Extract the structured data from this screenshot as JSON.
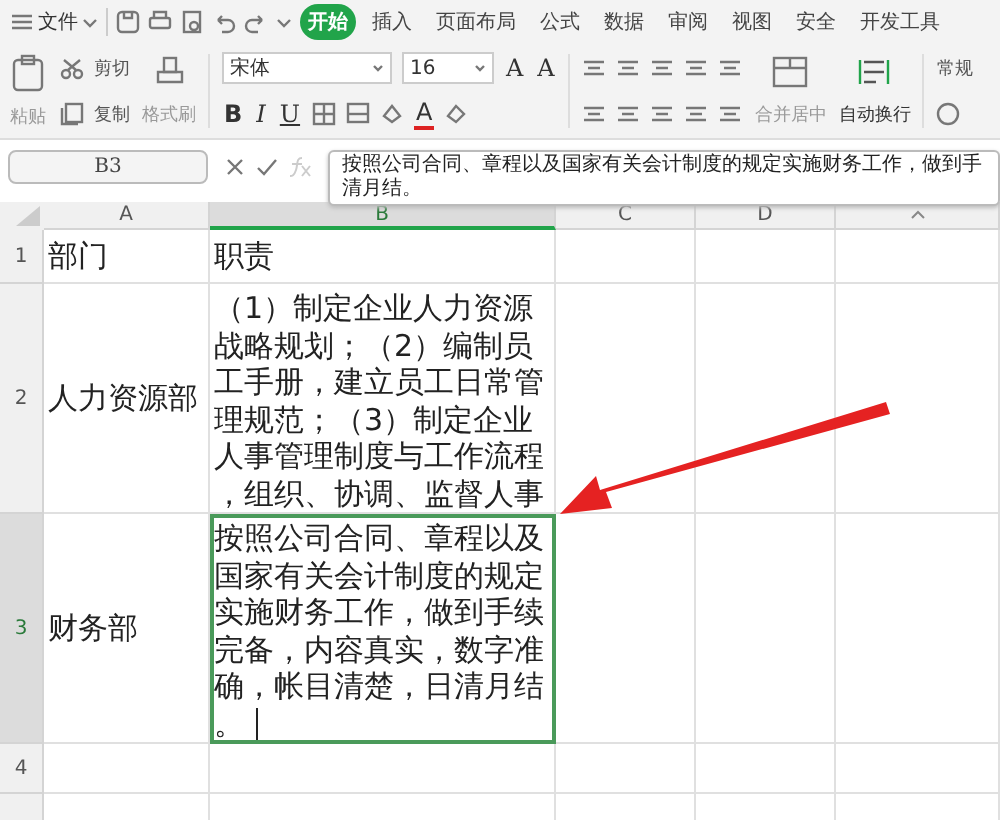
{
  "menu": {
    "file_label": "文件",
    "tabs": [
      {
        "label": "开始",
        "selected": true
      },
      {
        "label": "插入",
        "selected": false
      },
      {
        "label": "页面布局",
        "selected": false
      },
      {
        "label": "公式",
        "selected": false
      },
      {
        "label": "数据",
        "selected": false
      },
      {
        "label": "审阅",
        "selected": false
      },
      {
        "label": "视图",
        "selected": false
      },
      {
        "label": "安全",
        "selected": false
      },
      {
        "label": "开发工具",
        "selected": false
      }
    ]
  },
  "ribbon": {
    "paste": "粘贴",
    "cut": "剪切",
    "copy": "复制",
    "format_painter": "格式刷",
    "font_name": "宋体",
    "font_size": "16",
    "font_grow": "A",
    "font_shrink": "A",
    "bold": "B",
    "italic": "I",
    "underline": "U",
    "font_color": "A",
    "merge": "合并居中",
    "wrap": "自动换行",
    "number_format": "常规"
  },
  "formula_bar": {
    "name_box": "B3",
    "value_lines": [
      "按照公司合同、章程以及国家有关会计制度的规定实施财务工作，做到手",
      "清月结。"
    ]
  },
  "sheet": {
    "editing": true,
    "columns": [
      {
        "label": "A",
        "selected": false
      },
      {
        "label": "B",
        "selected": true
      },
      {
        "label": "C",
        "selected": false
      },
      {
        "label": "D",
        "selected": false
      }
    ],
    "rows": [
      {
        "number": "1",
        "selected": false,
        "cells": [
          "部门",
          "职责"
        ]
      },
      {
        "number": "2",
        "selected": false,
        "cells": [
          "人力资源部",
          "（1）制定企业人力资源战略规划；（2）编制员工手册，建立员工日常管理规范；（3）制定企业人事管理制度与工作流程，组织、协调、监督人事"
        ]
      },
      {
        "number": "3",
        "selected": true,
        "cells": [
          "财务部",
          "按照公司合同、章程以及国家有关会计制度的规定实施财务工作，做到手续完备，内容真实，数字准确，帐目清楚，日清月结。"
        ]
      },
      {
        "number": "4",
        "selected": false,
        "cells": []
      }
    ]
  }
}
